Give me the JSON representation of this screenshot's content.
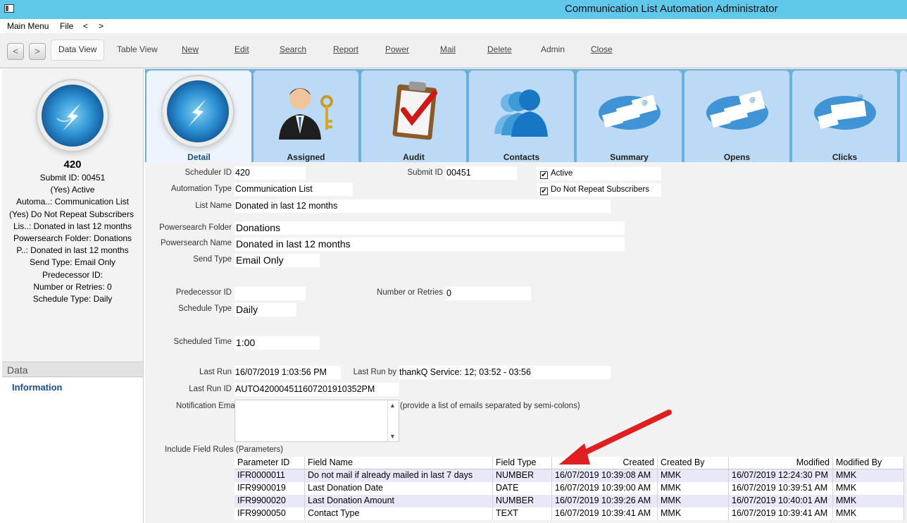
{
  "window": {
    "title": "Communication List Automation Administrator"
  },
  "menu": {
    "main_menu": "Main Menu",
    "file": "File",
    "back": "<",
    "forward": ">"
  },
  "toolbar": {
    "back": "<",
    "forward": ">",
    "buttons": [
      "Data View",
      "Table View",
      "New",
      "Edit",
      "Search",
      "Report",
      "Power",
      "Mail",
      "Delete",
      "Admin",
      "Close"
    ]
  },
  "sidebar": {
    "id": "420",
    "lines": [
      "Submit ID: 00451",
      "(Yes) Active",
      "Automa..: Communication List",
      "(Yes) Do Not Repeat Subscribers",
      "Lis..: Donated in last 12 months",
      "Powersearch Folder: Donations",
      "P..: Donated in last 12 months",
      "Send Type: Email Only",
      "Predecessor ID:",
      "Number or Retries: 0",
      "Schedule Type: Daily"
    ],
    "section": "Data",
    "link": "Information"
  },
  "tabs": [
    "Detail",
    "Assigned",
    "Audit",
    "Contacts",
    "Summary",
    "Opens",
    "Clicks"
  ],
  "form": {
    "scheduler_id_label": "Scheduler ID",
    "scheduler_id": "420",
    "submit_id_label": "Submit ID",
    "submit_id": "00451",
    "active_label": "Active",
    "active": true,
    "dnr_label": "Do Not Repeat Subscribers",
    "dnr": true,
    "automation_type_label": "Automation Type",
    "automation_type": "Communication List",
    "list_name_label": "List Name",
    "list_name": "Donated in last 12 months",
    "ps_folder_label": "Powersearch Folder",
    "ps_folder": "Donations",
    "ps_name_label": "Powersearch Name",
    "ps_name": "Donated in last 12 months",
    "send_type_label": "Send Type",
    "send_type": "Email Only",
    "predecessor_label": "Predecessor ID",
    "predecessor": "",
    "retries_label": "Number or Retries",
    "retries": "0",
    "schedule_type_label": "Schedule Type",
    "schedule_type": "Daily",
    "scheduled_time_label": "Scheduled Time",
    "scheduled_time": "1:00",
    "last_run_label": "Last Run",
    "last_run": "16/07/2019 1:03:56 PM",
    "last_run_by_label": "Last Run by",
    "last_run_by": "thankQ Service: 12; 03:52 - 03:56",
    "last_run_id_label": "Last Run ID",
    "last_run_id": "AUTO420004511607201910352PM",
    "notification_label": "Notification Email(s)",
    "notification_hint": "(provide a list of emails separated by semi-colons)",
    "include_rules_label": "Include Field Rules (Parameters)"
  },
  "grid": {
    "columns": [
      "Parameter ID",
      "Field Name",
      "Field Type",
      "Created",
      "Created By",
      "Modified",
      "Modified By"
    ],
    "rows": [
      [
        "IFR0000011",
        "Do not mail if already mailed in last 7 days",
        "NUMBER",
        "16/07/2019 10:39:08 AM",
        "MMK",
        "16/07/2019 12:24:30 PM",
        "MMK"
      ],
      [
        "IFR9900019",
        "Last Donation Date",
        "DATE",
        "16/07/2019 10:39:00 AM",
        "MMK",
        "16/07/2019 10:39:51 AM",
        "MMK"
      ],
      [
        "IFR9900020",
        "Last Donation Amount",
        "NUMBER",
        "16/07/2019 10:39:26 AM",
        "MMK",
        "16/07/2019 10:40:01 AM",
        "MMK"
      ],
      [
        "IFR9900050",
        "Contact Type",
        "TEXT",
        "16/07/2019 10:39:41 AM",
        "MMK",
        "16/07/2019 10:39:41 AM",
        "MMK"
      ]
    ]
  },
  "colors": {
    "titlebar": "#5fc8eb",
    "tabstrip": "#6ab0df",
    "tab": "#bcdaf5",
    "link": "#1a4d8c",
    "arrow": "#e02020"
  }
}
